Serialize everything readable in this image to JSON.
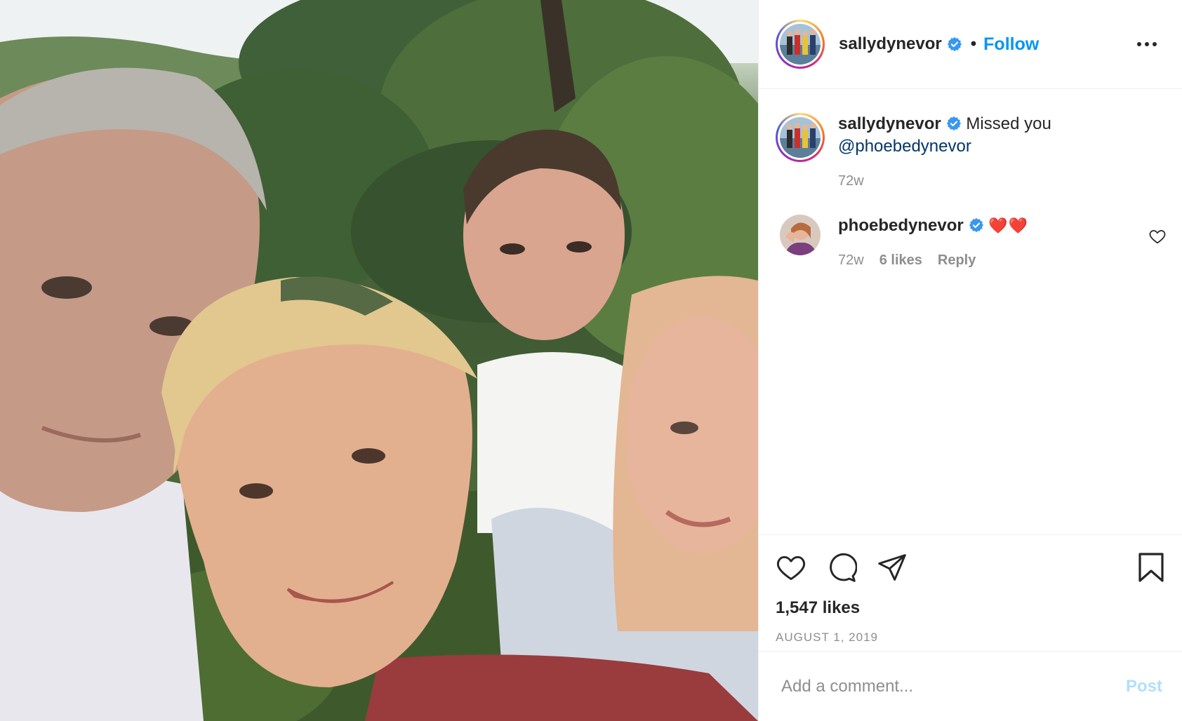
{
  "post": {
    "photo_description_icon": "family-selfie-photo",
    "header": {
      "username": "sallydynevor",
      "verified": true,
      "separator": "•",
      "follow_label": "Follow",
      "more_icon": "more-horizontal-icon"
    },
    "caption": {
      "username": "sallydynevor",
      "text": "Missed you",
      "mention": "@phoebedynevor",
      "time": "72w"
    },
    "comments": [
      {
        "username": "phoebedynevor",
        "verified": true,
        "text": "❤️❤️",
        "time": "72w",
        "likes": "6 likes",
        "reply_label": "Reply"
      }
    ],
    "actions": {
      "like_icon": "heart-icon",
      "comment_icon": "comment-icon",
      "share_icon": "share-icon",
      "save_icon": "bookmark-icon"
    },
    "likes_text": "1,547 likes",
    "date": "AUGUST 1, 2019",
    "add_comment": {
      "placeholder": "Add a comment...",
      "post_label": "Post"
    },
    "colors": {
      "accent": "#0095f6",
      "post_disabled": "#b2dffc",
      "mention": "#00376b",
      "secondary_text": "#8e8e8e",
      "border": "#efefef"
    }
  }
}
